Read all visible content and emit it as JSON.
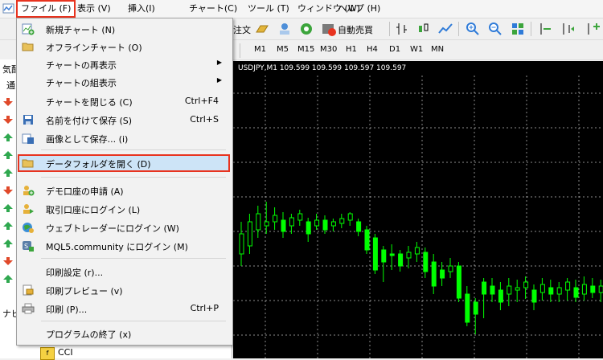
{
  "menubar": {
    "items": [
      "ファイル (F)",
      "表示 (V)",
      "挿入(I)",
      "チャート(C)",
      "ツール (T)",
      "ウィンドウ (W)",
      "ヘルプ (H)"
    ]
  },
  "toolbar": {
    "order_label": "注文",
    "auto_trade_label": "自動売買"
  },
  "timeframes": [
    "M1",
    "M5",
    "M15",
    "M30",
    "H1",
    "H4",
    "D1",
    "W1",
    "MN"
  ],
  "chart": {
    "title": "USDJPY,M1  109.599 109.599 109.597 109.597",
    "bull_color": "#00ff00",
    "grid_color": "#ffffff"
  },
  "left_panel": {
    "header_market": "気配",
    "tab_label": "通",
    "nav_header": "ナビ",
    "bottom_item": "CCI"
  },
  "file_menu": {
    "items": [
      {
        "label": "新規チャート (N)",
        "shortcut": "",
        "submenu": false,
        "icon": "new-chart-icon"
      },
      {
        "label": "オフラインチャート (O)",
        "shortcut": "",
        "submenu": false,
        "icon": "folder-open-icon"
      },
      {
        "label": "チャートの再表示",
        "shortcut": "",
        "submenu": true,
        "icon": ""
      },
      {
        "label": "チャートの組表示",
        "shortcut": "",
        "submenu": true,
        "icon": ""
      },
      {
        "label": "チャートを閉じる (C)",
        "shortcut": "Ctrl+F4",
        "submenu": false,
        "icon": ""
      },
      {
        "label": "名前を付けて保存 (S)",
        "shortcut": "Ctrl+S",
        "submenu": false,
        "icon": "save-icon"
      },
      {
        "label": "画像として保存... (i)",
        "shortcut": "",
        "submenu": false,
        "icon": "save-image-icon"
      },
      {
        "label": "データフォルダを開く (D)",
        "shortcut": "",
        "submenu": false,
        "icon": "data-folder-icon"
      },
      {
        "label": "デモ口座の申請 (A)",
        "shortcut": "",
        "submenu": false,
        "icon": "demo-account-icon"
      },
      {
        "label": "取引口座にログイン (L)",
        "shortcut": "",
        "submenu": false,
        "icon": "login-icon"
      },
      {
        "label": "ウェブトレーダーにログイン (W)",
        "shortcut": "",
        "submenu": false,
        "icon": "web-trader-icon"
      },
      {
        "label": "MQL5.community にログイン (M)",
        "shortcut": "",
        "submenu": false,
        "icon": "mql5-icon"
      },
      {
        "label": "印刷設定 (r)...",
        "shortcut": "",
        "submenu": false,
        "icon": ""
      },
      {
        "label": "印刷プレビュー (v)",
        "shortcut": "",
        "submenu": false,
        "icon": "print-preview-icon"
      },
      {
        "label": "印刷 (P)...",
        "shortcut": "Ctrl+P",
        "submenu": false,
        "icon": "print-icon"
      },
      {
        "label": "プログラムの終了 (x)",
        "shortcut": "",
        "submenu": false,
        "icon": ""
      }
    ]
  }
}
